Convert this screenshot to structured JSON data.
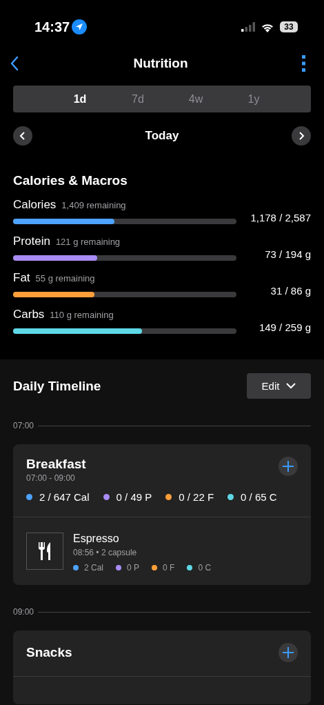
{
  "status_bar": {
    "time": "14:37",
    "battery": "33"
  },
  "nav": {
    "title": "Nutrition"
  },
  "range_tabs": [
    {
      "label": "1d",
      "selected": true
    },
    {
      "label": "7d",
      "selected": false
    },
    {
      "label": "4w",
      "selected": false
    },
    {
      "label": "1y",
      "selected": false
    }
  ],
  "date_nav": {
    "label": "Today"
  },
  "macros": {
    "title": "Calories & Macros",
    "items": [
      {
        "name": "Calories",
        "remaining": "1,409 remaining",
        "reading": "1,178 / 2,587",
        "level": 0.455,
        "color": "#4da3ff"
      },
      {
        "name": "Protein",
        "remaining": "121 g remaining",
        "reading": "73 / 194 g",
        "level": 0.376,
        "color": "#a98cf5"
      },
      {
        "name": "Fat",
        "remaining": "55 g remaining",
        "reading": "31 / 86 g",
        "level": 0.364,
        "color": "#ff9f3a"
      },
      {
        "name": "Carbs",
        "remaining": "110 g remaining",
        "reading": "149 / 259 g",
        "level": 0.577,
        "color": "#5fd8e6"
      }
    ]
  },
  "timeline": {
    "title": "Daily Timeline",
    "edit_button": "Edit",
    "slots": [
      {
        "time": "07:00",
        "meals": [
          {
            "name": "Breakfast",
            "hours": "07:00 - 09:00",
            "totals": [
              {
                "text": "2 / 647 Cal",
                "color": "#4da3ff"
              },
              {
                "text": "0 / 49 P",
                "color": "#a98cf5"
              },
              {
                "text": "0 / 22 F",
                "color": "#ff9f3a"
              },
              {
                "text": "0 / 65 C",
                "color": "#5fd8e6"
              }
            ],
            "foods": [
              {
                "name": "Espresso",
                "detail": "08:56 • 2 capsule",
                "values": [
                  {
                    "text": "2 Cal",
                    "color": "#4da3ff"
                  },
                  {
                    "text": "0 P",
                    "color": "#a98cf5"
                  },
                  {
                    "text": "0 F",
                    "color": "#ff9f3a"
                  },
                  {
                    "text": "0 C",
                    "color": "#5fd8e6"
                  }
                ]
              }
            ]
          }
        ]
      },
      {
        "time": "09:00",
        "meals": [
          {
            "name": "Snacks"
          }
        ]
      }
    ]
  }
}
